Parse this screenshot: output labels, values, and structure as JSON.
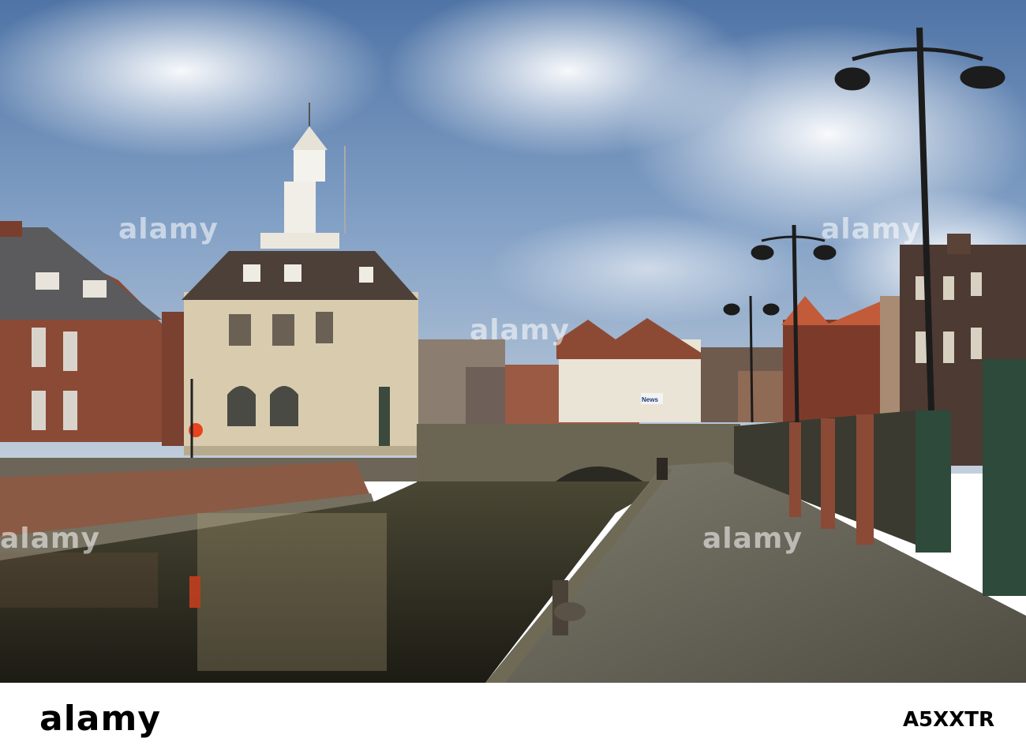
{
  "photo": {
    "scene": "riverside quay with customs house, bridge and street lamps",
    "colors": {
      "sky": "#6e8fb8",
      "water": "#3b3a2c",
      "brick": "#8a4a36",
      "stone": "#d9ccae"
    }
  },
  "watermark": {
    "text": "alamy"
  },
  "sign": {
    "news": "News"
  },
  "footer": {
    "brand": "alamy",
    "image_id": "A5XXTR"
  }
}
